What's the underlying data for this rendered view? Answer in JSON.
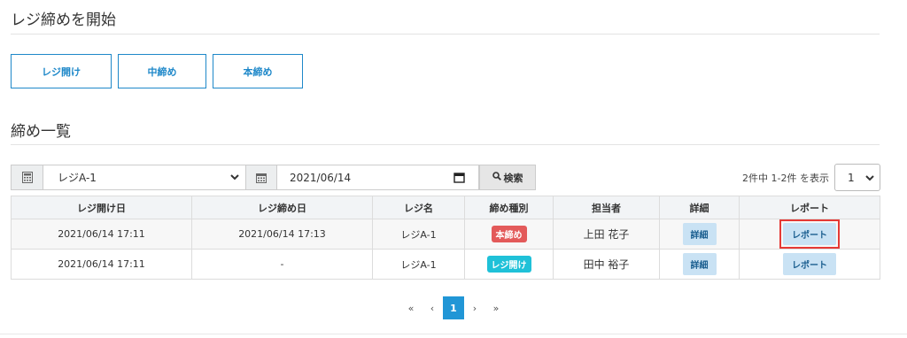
{
  "start_section": {
    "title": "レジ締めを開始",
    "buttons": [
      "レジ開け",
      "中締め",
      "本締め"
    ]
  },
  "list_section": {
    "title": "締め一覧"
  },
  "filters": {
    "register_value": "レジA-1",
    "date_value": "2021/06/14",
    "search_label": "検索"
  },
  "summary": {
    "count_text": "2件中 1-2件 を表示",
    "per_page": "1"
  },
  "table": {
    "headers": [
      "レジ開け日",
      "レジ締め日",
      "レジ名",
      "締め種別",
      "担当者",
      "詳細",
      "レポート"
    ],
    "rows": [
      {
        "open_date": "2021/06/14 17:11",
        "close_date": "2021/06/14 17:13",
        "register": "レジA-1",
        "type": "本締め",
        "staff": "上田 花子",
        "detail": "詳細",
        "report": "レポート"
      },
      {
        "open_date": "2021/06/14 17:11",
        "close_date": "-",
        "register": "レジA-1",
        "type": "レジ開け",
        "staff": "田中 裕子",
        "detail": "詳細",
        "report": "レポート"
      }
    ]
  },
  "pagination": {
    "first": "«",
    "prev": "‹",
    "current": "1",
    "next": "›",
    "last": "»"
  },
  "colors": {
    "accent": "#1e88c9",
    "badge_close": "#e35a5a",
    "badge_open": "#1fc1d8",
    "highlight": "#e53935"
  }
}
